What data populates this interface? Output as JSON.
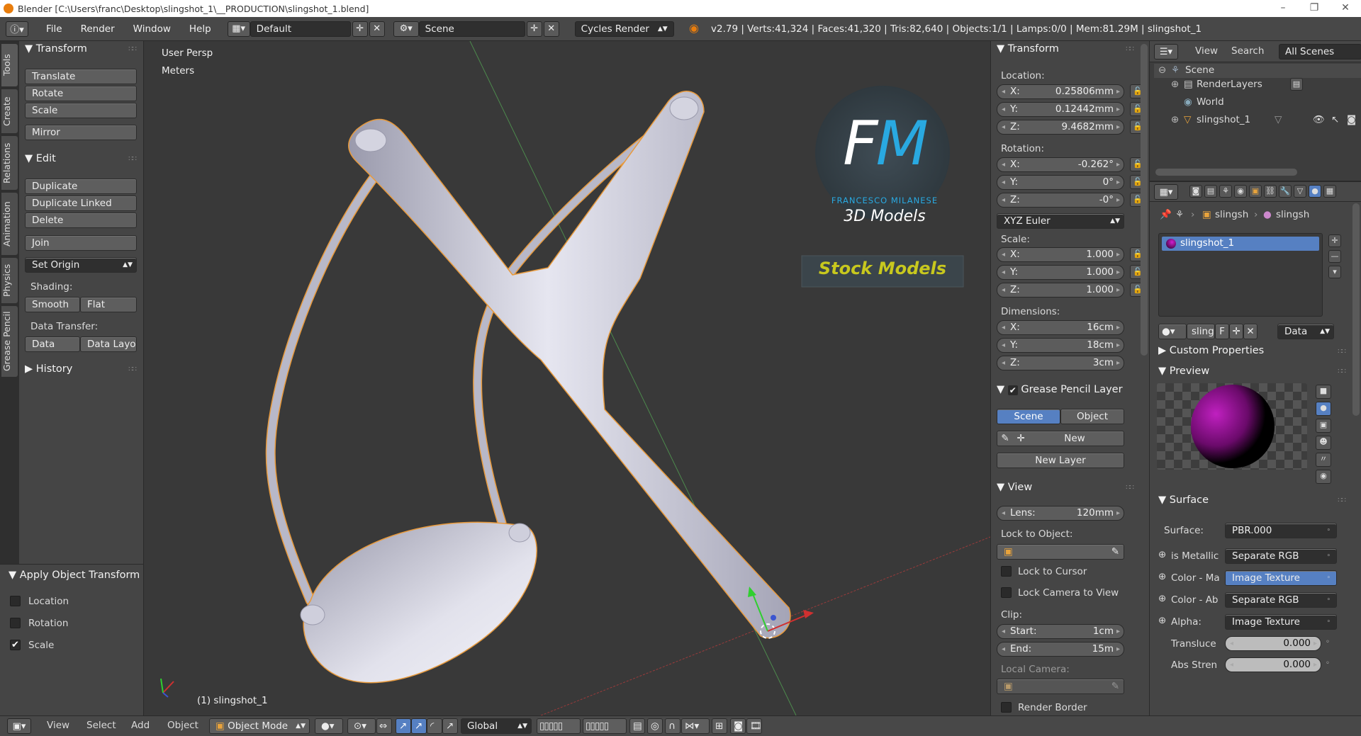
{
  "window": {
    "title": "Blender [C:\\Users\\franc\\Desktop\\slingshot_1\\__PRODUCTION\\slingshot_1.blend]",
    "controls": [
      "–",
      "❐",
      "✕"
    ]
  },
  "topbar": {
    "menus": [
      "File",
      "Render",
      "Window",
      "Help"
    ],
    "layout": "Default",
    "scene": "Scene",
    "engine": "Cycles Render",
    "stats": "v2.79 | Verts:41,324 | Faces:41,320 | Tris:82,640 | Objects:1/1 | Lamps:0/0 | Mem:81.29M | slingshot_1"
  },
  "tabs": [
    "Tools",
    "Create",
    "Relations",
    "Animation",
    "Physics",
    "Grease Pencil"
  ],
  "toolshelf": {
    "transform_header": "Transform",
    "translate": "Translate",
    "rotate": "Rotate",
    "scale": "Scale",
    "mirror": "Mirror",
    "edit_header": "Edit",
    "duplicate": "Duplicate",
    "duplicate_linked": "Duplicate Linked",
    "delete": "Delete",
    "join": "Join",
    "set_origin": "Set Origin",
    "shading_label": "Shading:",
    "smooth": "Smooth",
    "flat": "Flat",
    "data_transfer_label": "Data Transfer:",
    "data": "Data",
    "data_layo": "Data Layo",
    "history_header": "History"
  },
  "operator": {
    "header": "Apply Object Transform",
    "location": {
      "label": "Location",
      "checked": false
    },
    "rotation": {
      "label": "Rotation",
      "checked": false
    },
    "scale": {
      "label": "Scale",
      "checked": true
    }
  },
  "viewport": {
    "view_name": "User Persp",
    "units": "Meters",
    "object_label": "(1) slingshot_1",
    "logo_fm": "FM",
    "logo_name": "FRANCESCO MILANESE",
    "logo_sub": "3D Models",
    "logo_banner": "Stock Models",
    "colors": {
      "object": "#c9c9d6",
      "outline": "#e89a3c",
      "logo_blue": "#29a9e1",
      "banner_text": "#c8c81e"
    }
  },
  "npanel": {
    "transform_header": "Transform",
    "location_label": "Location:",
    "loc": [
      {
        "axis": "X:",
        "value": "0.25806mm"
      },
      {
        "axis": "Y:",
        "value": "0.12442mm"
      },
      {
        "axis": "Z:",
        "value": "9.4682mm"
      }
    ],
    "rotation_label": "Rotation:",
    "rot": [
      {
        "axis": "X:",
        "value": "-0.262°"
      },
      {
        "axis": "Y:",
        "value": "0°"
      },
      {
        "axis": "Z:",
        "value": "-0°"
      }
    ],
    "rotation_mode": "XYZ Euler",
    "scale_label": "Scale:",
    "scl": [
      {
        "axis": "X:",
        "value": "1.000"
      },
      {
        "axis": "Y:",
        "value": "1.000"
      },
      {
        "axis": "Z:",
        "value": "1.000"
      }
    ],
    "dimensions_label": "Dimensions:",
    "dim": [
      {
        "axis": "X:",
        "value": "16cm"
      },
      {
        "axis": "Y:",
        "value": "18cm"
      },
      {
        "axis": "Z:",
        "value": "3cm"
      }
    ],
    "gp_header": "Grease Pencil Layer",
    "gp_scene": "Scene",
    "gp_object": "Object",
    "gp_new": "New",
    "gp_new_layer": "New Layer",
    "view_header": "View",
    "lens_label": "Lens:",
    "lens_value": "120mm",
    "lock_object_label": "Lock to Object:",
    "lock_cursor": "Lock to Cursor",
    "lock_camera": "Lock Camera to View",
    "clip_label": "Clip:",
    "clip_start_label": "Start:",
    "clip_start": "1cm",
    "clip_end_label": "End:",
    "clip_end": "15m",
    "local_camera": "Local Camera:",
    "render_border": "Render Border"
  },
  "outliner": {
    "menus": [
      "View",
      "Search"
    ],
    "filter": "All Scenes",
    "items": [
      "Scene",
      "RenderLayers",
      "World",
      "slingshot_1"
    ]
  },
  "properties": {
    "breadcrumb": [
      "slingsh",
      "slingsh"
    ],
    "material_slot": "slingshot_1",
    "mat_name": "slings",
    "mat_f": "F",
    "link": "Data",
    "custom_props": "Custom Properties",
    "preview": "Preview",
    "surface_header": "Surface",
    "surface_label": "Surface:",
    "surface_value": "PBR.000",
    "rows": [
      {
        "label": "is Metallic",
        "value": "Separate RGB"
      },
      {
        "label": "Color - Ma",
        "value": "Image Texture"
      },
      {
        "label": "Color - Ab",
        "value": "Separate RGB"
      },
      {
        "label": "Alpha:",
        "value": "Image Texture"
      }
    ],
    "translucent_label": "Transluce",
    "translucent_value": "0.000",
    "abs_label": "Abs Stren",
    "abs_value": "0.000"
  },
  "bottombar": {
    "menus": [
      "View",
      "Select",
      "Add",
      "Object"
    ],
    "mode": "Object Mode",
    "orientation": "Global"
  }
}
